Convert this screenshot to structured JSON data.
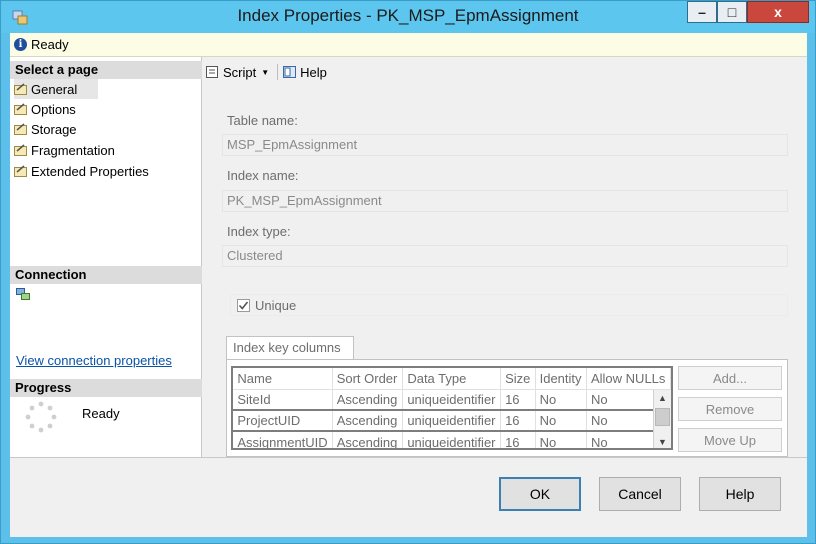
{
  "window": {
    "title": "Index Properties - PK_MSP_EpmAssignment",
    "minimize_glyph": "–",
    "maximize_glyph": "□",
    "close_glyph": "x"
  },
  "status": {
    "text": "Ready",
    "icon": "info-icon"
  },
  "left_pane": {
    "select_page_header": "Select a page",
    "pages": [
      {
        "label": "General",
        "selected": true
      },
      {
        "label": "Options",
        "selected": false
      },
      {
        "label": "Storage",
        "selected": false
      },
      {
        "label": "Fragmentation",
        "selected": false
      },
      {
        "label": "Extended Properties",
        "selected": false
      }
    ],
    "connection_header": "Connection",
    "connection_link": "View connection properties",
    "progress_header": "Progress",
    "progress_status": "Ready"
  },
  "toolbar": {
    "script_label": "Script",
    "help_label": "Help"
  },
  "form": {
    "table_name_label": "Table name:",
    "table_name_value": "MSP_EpmAssignment",
    "index_name_label": "Index name:",
    "index_name_value": "PK_MSP_EpmAssignment",
    "index_type_label": "Index type:",
    "index_type_value": "Clustered",
    "unique_label": "Unique",
    "unique_checked": true
  },
  "index_key_columns": {
    "tab_label": "Index key columns",
    "columns": [
      "Name",
      "Sort Order",
      "Data Type",
      "Size",
      "Identity",
      "Allow NULLs"
    ],
    "rows": [
      [
        "SiteId",
        "Ascending",
        "uniqueidentifier",
        "16",
        "No",
        "No"
      ],
      [
        "ProjectUID",
        "Ascending",
        "uniqueidentifier",
        "16",
        "No",
        "No"
      ],
      [
        "AssignmentUID",
        "Ascending",
        "uniqueidentifier",
        "16",
        "No",
        "No"
      ]
    ],
    "buttons": {
      "add": "Add...",
      "remove": "Remove",
      "move_up": "Move Up"
    }
  },
  "dialog_buttons": {
    "ok": "OK",
    "cancel": "Cancel",
    "help": "Help"
  }
}
